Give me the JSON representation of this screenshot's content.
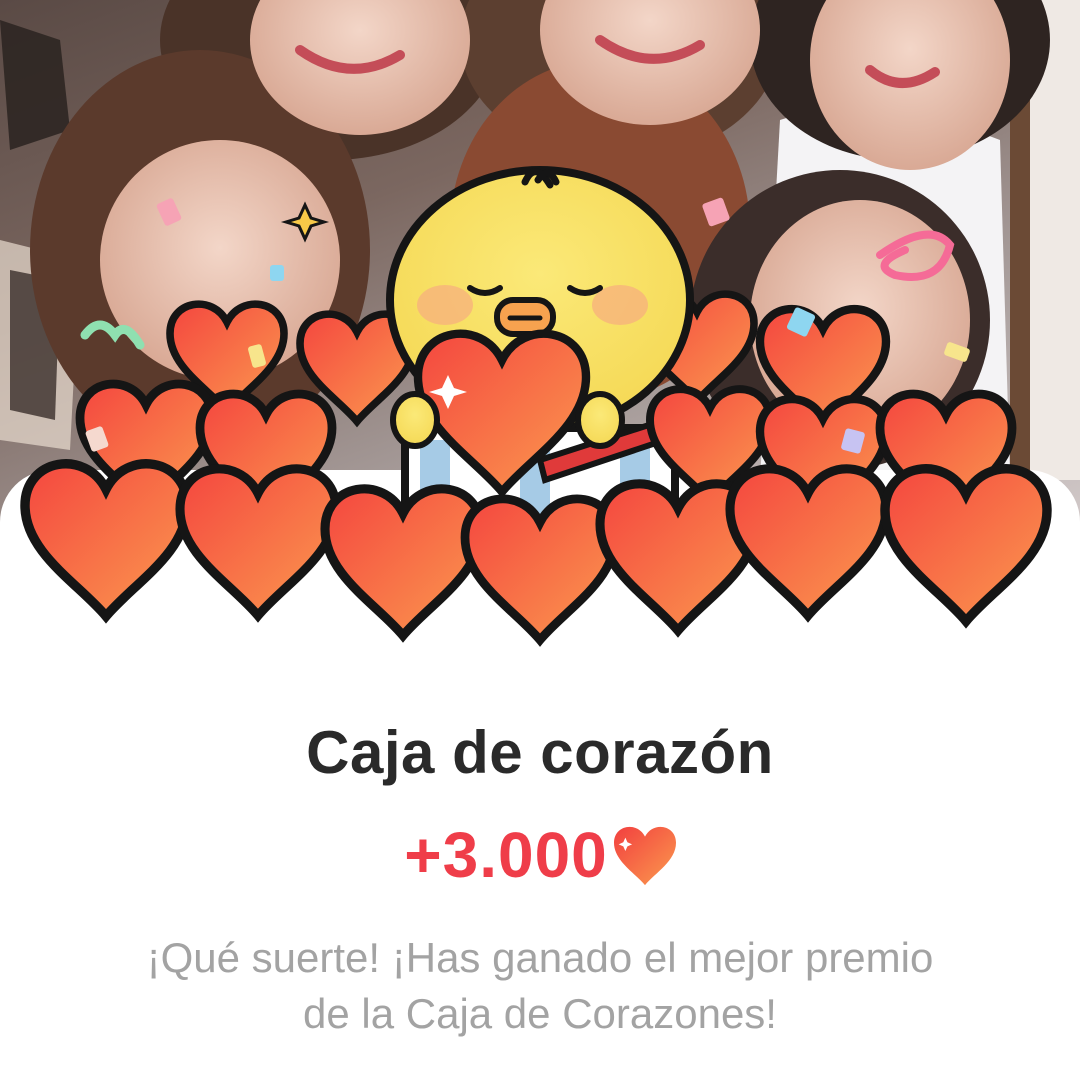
{
  "dialog": {
    "title": "Caja de corazón",
    "reward_amount": "+3.000",
    "message_line1": "¡Qué suerte! ¡Has ganado el mejor premio",
    "message_line2": "de la Caja de Corazones!"
  },
  "icons": {
    "reward_icon": "heart-icon",
    "illustration": "chick-holding-heart-in-gift-box"
  },
  "colors": {
    "reward_red": "#ef3d49",
    "heart_orange": "#f7804a",
    "title_text": "#2a2a2a",
    "message_text": "#a3a3a3",
    "chick_yellow": "#f9e56e"
  }
}
